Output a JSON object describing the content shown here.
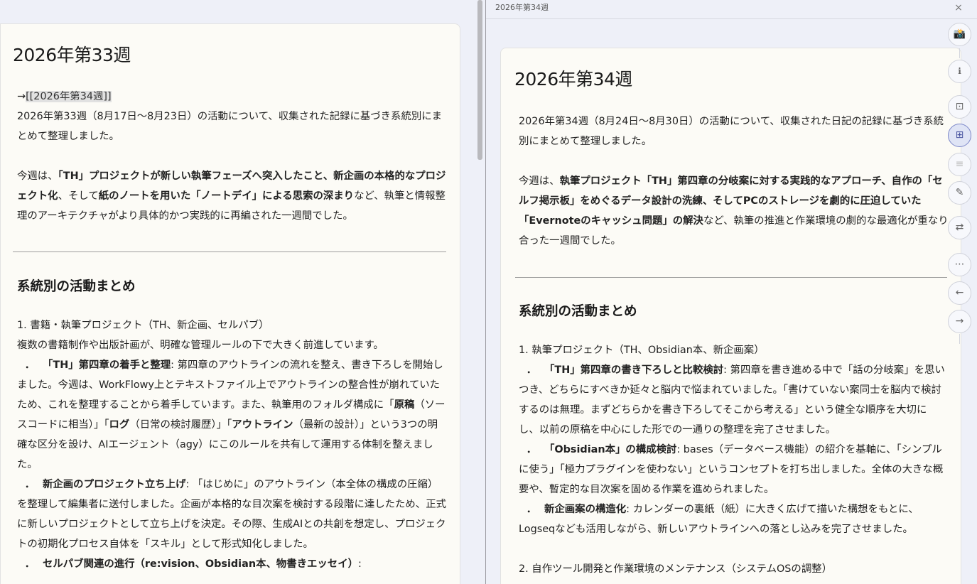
{
  "left": {
    "title": "2026年第33週",
    "nav_arrow": "→",
    "nav_link": "[[2026年第34週]]",
    "intro": "2026年第33週（8月17日〜8月23日）の活動について、収集された記録に基づき系統別にまとめて整理しました。",
    "summary_lead": "今週は、",
    "summary_b1": "「TH」プロジェクトが新しい執筆フェーズへ突入したこと、新企画の本格的なプロジェクト化",
    "summary_mid": "、そして",
    "summary_b2": "紙のノートを用いた「ノートデイ」による思索の深まり",
    "summary_tail": "など、執筆と情報整理のアーキテクチャがより具体的かつ実践的に再編された一週間でした。",
    "section_heading": "系統別の活動まとめ",
    "list_heading": "1. 書籍・執筆プロジェクト（TH、新企画、セルパブ）",
    "list_intro": "複数の書籍制作や出版計画が、明確な管理ルールの下で大きく前進しています。",
    "bullet": "．",
    "item1_title": "「TH」第四章の着手と整理",
    "item1_body_a": ": 第四章のアウトラインの流れを整え、書き下ろしを開始しました。今週は、WorkFlowy上とテキストファイル上でアウトラインの整合性が崩れていたため、これを整理することから着手しています。また、執筆用のフォルダ構成に「",
    "item1_b1": "原稿",
    "item1_body_b": "（ソースコードに相当）」「",
    "item1_b2": "ログ",
    "item1_body_c": "（日常の検討履歴）」「",
    "item1_b3": "アウトライン",
    "item1_body_d": "（最新の設計）」という3つの明確な区分を設け、AIエージェント（agy）にこのルールを共有して運用する体制を整えました。",
    "item2_title": "新企画のプロジェクト立ち上げ",
    "item2_body": ": 「はじめに」のアウトライン（本全体の構成の圧縮）を整理して編集者に送付しました。企画が本格的な目次案を検討する段階に達したため、正式に新しいプロジェクトとして立ち上げを決定。その際、生成AIとの共創を想定し、プロジェクトの初期化プロセス自体を「スキル」として形式知化しました。",
    "item3_title": "セルパブ関連の進行（re:vision、Obsidian本、物書きエッセイ）",
    "item3_body": ":"
  },
  "right": {
    "header_title": "2026年第34週",
    "close_label": "×",
    "title": "2026年第34週",
    "intro": "2026年第34週（8月24日〜8月30日）の活動について、収集された日記の記録に基づき系統別にまとめて整理しました。",
    "summary_lead": "今週は、",
    "summary_b1": "執筆プロジェクト「TH」第四章の分岐案に対する実践的なアプローチ、自作の「セルフ掲示板」をめぐるデータ設計の洗練、そしてPCのストレージを劇的に圧迫していた「Evernoteのキャッシュ問題」の解決",
    "summary_tail": "など、執筆の推進と作業環境の劇的な最適化が重なり合った一週間でした。",
    "section_heading": "系統別の活動まとめ",
    "list_heading": "1. 執筆プロジェクト（TH、Obsidian本、新企画案）",
    "bullet": "．",
    "item1_title": "「TH」第四章の書き下ろしと比較検討",
    "item1_body": ": 第四章を書き進める中で「話の分岐案」を思いつき、どちらにすべきか延々と脳内で悩まれていました。「書けていない案同士を脳内で検討するのは無理。まずどちらかを書き下ろしてそこから考える」という健全な順序を大切にし、以前の原稿を中心にした形での一通りの整理を完了させました。",
    "item2_title": "「Obsidian本」の構成検討",
    "item2_body": ": bases（データベース機能）の紹介を基軸に、「シンプルに使う」「極力プラグインを使わない」というコンセプトを打ち出しました。全体の大きな概要や、暫定的な目次案を固める作業を進められました。",
    "item3_title": "新企画案の構造化",
    "item3_body": ": カレンダーの裏紙（紙）に大きく広げて描いた構想をもとに、Logseqなども活用しながら、新しいアウトラインへの落とし込みを完了させました。",
    "list2_heading": "2. 自作ツール開発と作業環境のメンテナンス（システムOSの調整）"
  },
  "toolbar": {
    "camera": "📸",
    "info": "ℹ",
    "frame": "⊡",
    "grid": "⊞",
    "lines": "≡",
    "pen": "✎",
    "swap": "⇄",
    "more": "⋯",
    "back": "←",
    "forward": "→"
  }
}
